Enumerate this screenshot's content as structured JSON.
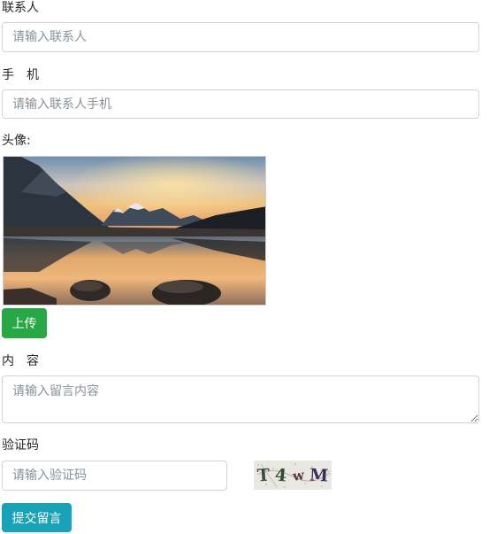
{
  "contact": {
    "label": "联系人",
    "placeholder": "请输入联系人"
  },
  "phone": {
    "label": "手　机",
    "placeholder": "请输入联系人手机"
  },
  "avatar": {
    "label": "头像:",
    "image": "mountain-lake-photo",
    "upload_label": "上传",
    "upload_color": "#28a745"
  },
  "content": {
    "label": "内　容",
    "placeholder": "请输入留言内容"
  },
  "captcha": {
    "label": "验证码",
    "placeholder": "请输入验证码",
    "chars": [
      "T",
      "4",
      "w",
      "M"
    ]
  },
  "submit": {
    "label": "提交留言",
    "color": "#17a2b8"
  }
}
